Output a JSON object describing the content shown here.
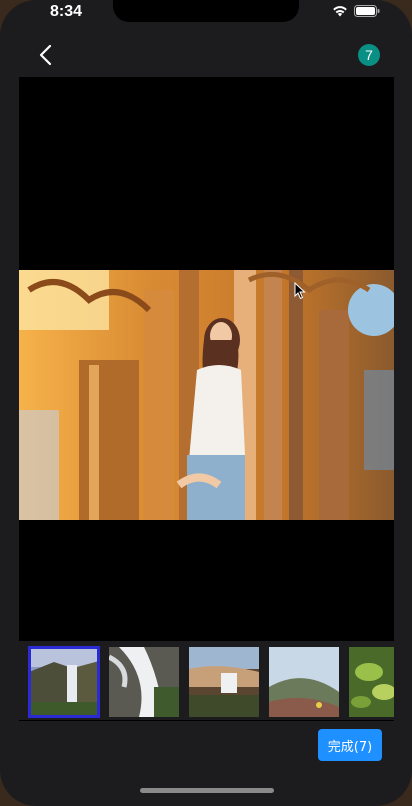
{
  "status_bar": {
    "time": "8:34"
  },
  "header": {
    "back_icon": "chevron-left-icon",
    "selected_count": "7"
  },
  "preview": {
    "image": "photo-woman-in-ornate-hall",
    "colors": {
      "background": "#000000"
    }
  },
  "thumbnails": [
    {
      "image": "waterfall-cliff",
      "selected": true
    },
    {
      "image": "frozen-waterfall",
      "selected": false
    },
    {
      "image": "waterfall-valley",
      "selected": false
    },
    {
      "image": "coastal-hillside",
      "selected": false
    },
    {
      "image": "green-leaves",
      "selected": false
    }
  ],
  "footer": {
    "done_label": "完成(7)"
  },
  "colors": {
    "accent": "#1e90ff",
    "badge": "#0a8f85",
    "selection": "#2b2bd6"
  }
}
